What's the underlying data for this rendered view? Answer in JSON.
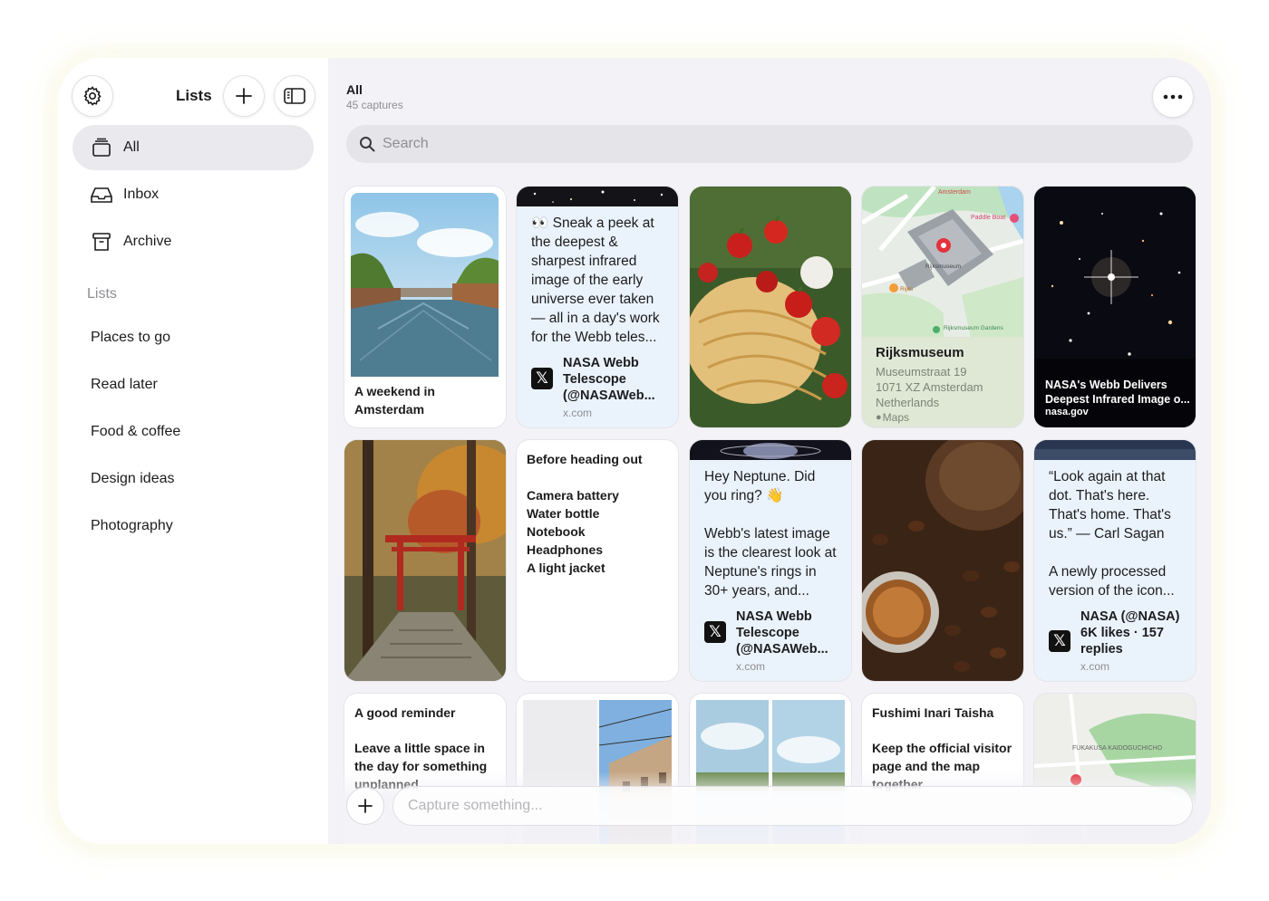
{
  "sidebar": {
    "title": "Lists",
    "nav": [
      {
        "label": "All",
        "icon": "stack-icon",
        "active": true
      },
      {
        "label": "Inbox",
        "icon": "inbox-tray-icon"
      },
      {
        "label": "Archive",
        "icon": "archive-box-icon"
      }
    ],
    "lists_heading": "Lists",
    "lists": [
      "Places to go",
      "Read later",
      "Food & coffee",
      "Design ideas",
      "Photography"
    ]
  },
  "header": {
    "title": "All",
    "subtitle": "45 captures"
  },
  "search": {
    "placeholder": "Search"
  },
  "cards": {
    "amsterdam": {
      "title": "A weekend in Amsterdam"
    },
    "tweet_webb": {
      "text": "👀 Sneak a peek at the deepest & sharpest infrared image of the early universe ever taken — all in a day's work for the Webb teles...",
      "author": "NASA Webb Telescope (@NASAWeb...",
      "domain": "x.com"
    },
    "map_place": {
      "name": "Rijksmuseum",
      "address1": "Museumstraat 19",
      "address2": "1071 XZ Amsterdam",
      "country": "Netherlands",
      "source": "Maps",
      "map_labels": [
        "Amsterdam",
        "Paddle Boat",
        "Rijksmuseum",
        "Rijks",
        "Rijksmuseum Gardens"
      ]
    },
    "nasa_link": {
      "title": "NASA's Webb Delivers Deepest Infrared Image o...",
      "domain": "nasa.gov"
    },
    "note_heading_out": {
      "title": "Before heading out",
      "items": [
        "Camera battery",
        "Water bottle",
        "Notebook",
        "Headphones",
        "A light jacket"
      ]
    },
    "tweet_neptune": {
      "text1": "Hey Neptune. Did you ring? 👋",
      "text2": "Webb's latest image is the clearest look at Neptune's rings in 30+ years, and...",
      "author": "NASA Webb Telescope (@NASAWeb...",
      "domain": "x.com"
    },
    "tweet_sagan": {
      "text1": "“Look again at that dot. That's here. That's home. That's us.” — Carl Sagan",
      "text2": "A newly processed version of the icon...",
      "author": "NASA (@NASA) 6K likes · 157 replies",
      "domain": "x.com"
    },
    "note_reminder": {
      "title": "A good reminder",
      "body": "Leave a little space in the day for something unplanned"
    },
    "note_fushimi": {
      "title": "Fushimi Inari Taisha",
      "body": "Keep the official visitor page and the map together"
    },
    "map2": {
      "labels": [
        "FUKAKUSA KAIDOGUCHICHO"
      ]
    }
  },
  "capture": {
    "placeholder": "Capture something..."
  },
  "colors": {
    "accent": "#1c1c1e",
    "tweet_bg": "#eaf3fb",
    "sidebar_active": "#e9e9ee"
  }
}
